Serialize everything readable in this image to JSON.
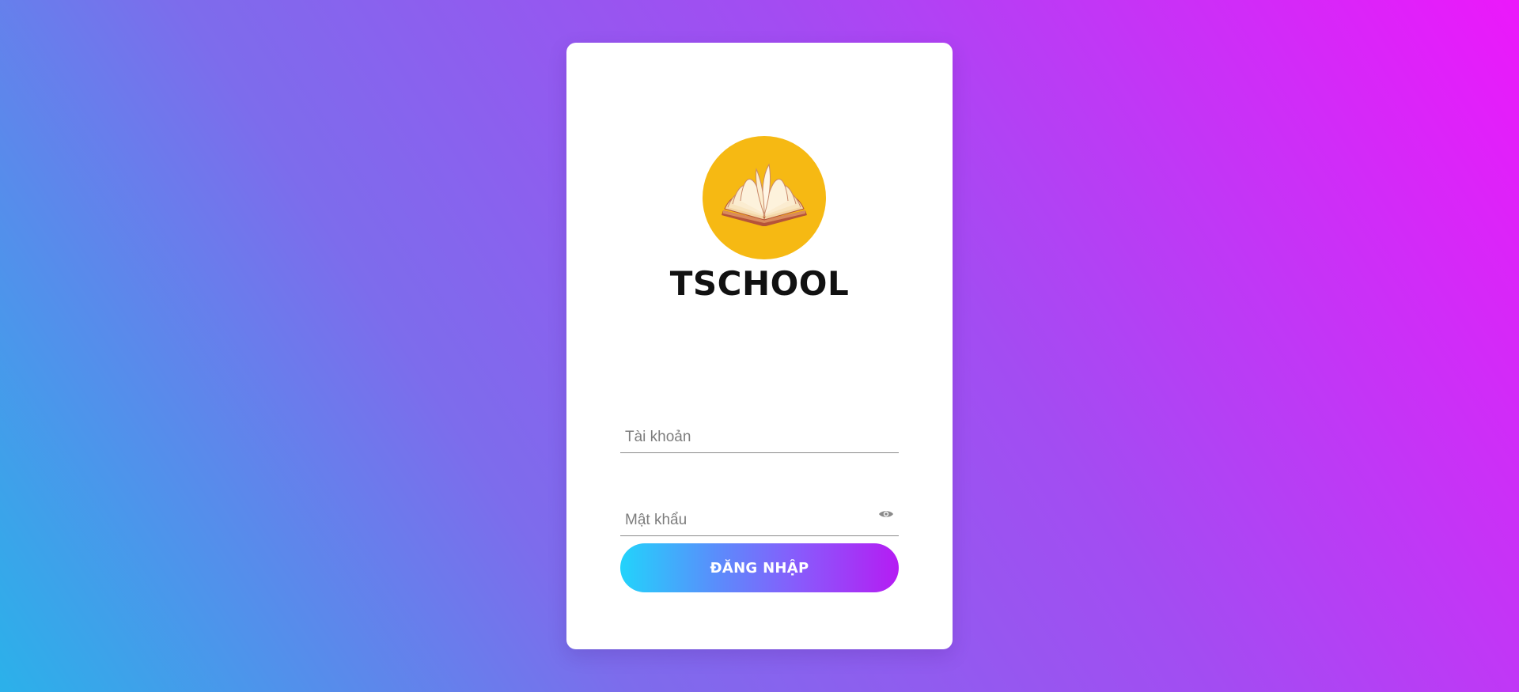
{
  "brand": {
    "name": "TSCHOOL",
    "logo_icon": "open-book-icon",
    "logo_color": "#f6b913"
  },
  "form": {
    "username_placeholder": "Tài khoản",
    "username_value": "",
    "password_placeholder": "Mật khẩu",
    "password_value": "",
    "toggle_icon": "eye-icon",
    "submit_label": "ĐĂNG NHẬP"
  },
  "colors": {
    "background_start": "#2bb1ea",
    "background_end": "#ec18fb",
    "button_start": "#22d3fb",
    "button_end": "#b51cf3",
    "card": "#ffffff"
  }
}
